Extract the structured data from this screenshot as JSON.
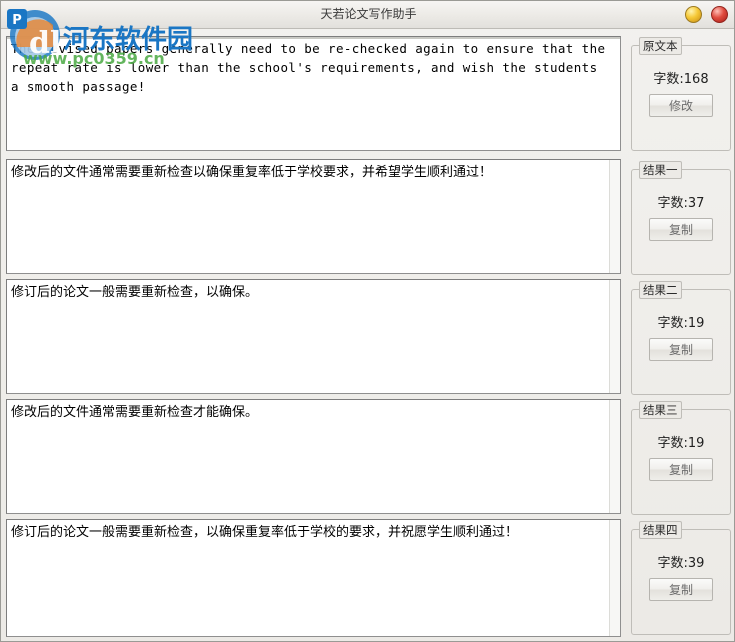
{
  "window": {
    "title": "天若论文写作助手",
    "minimize_label": "",
    "close_label": ""
  },
  "watermark": {
    "brand": "河东软件园",
    "url": "www.pc0359.cn",
    "logo_letter": "P"
  },
  "editors": [
    {
      "name": "original-text",
      "text": "The revised papers generally need to be re-checked again to ensure that the repeat rate is lower than the school's requirements, and wish the students a smooth passage!"
    },
    {
      "name": "result-one-text",
      "text": "修改后的文件通常需要重新检查以确保重复率低于学校要求，并希望学生顺利通过！"
    },
    {
      "name": "result-two-text",
      "text": "修订后的论文一般需要重新检查，以确保。"
    },
    {
      "name": "result-three-text",
      "text": "修改后的文件通常需要重新检查才能确保。"
    },
    {
      "name": "result-four-text",
      "text": "修订后的论文一般需要重新检查，以确保重复率低于学校的要求，并祝愿学生顺利通过！"
    }
  ],
  "panels": [
    {
      "legend": "原文本",
      "count_label": "字数:168",
      "button_label": "修改",
      "button_role": "modify"
    },
    {
      "legend": "结果一",
      "count_label": "字数:37",
      "button_label": "复制",
      "button_role": "copy"
    },
    {
      "legend": "结果二",
      "count_label": "字数:19",
      "button_label": "复制",
      "button_role": "copy"
    },
    {
      "legend": "结果三",
      "count_label": "字数:19",
      "button_label": "复制",
      "button_role": "copy"
    },
    {
      "legend": "结果四",
      "count_label": "字数:39",
      "button_label": "复制",
      "button_role": "copy"
    }
  ],
  "colors": {
    "titlebar_top": "#f6f5f3",
    "titlebar_bottom": "#e2e0dc",
    "app_background": "#eceae6",
    "editor_background": "#ffffff",
    "minimize_button": "#f5c836",
    "close_button": "#e04c3f",
    "watermark_blue": "#1a76c4",
    "watermark_green": "#49a942",
    "watermark_orange": "#ef8023",
    "groupbox_border": "#bfbdb8"
  }
}
